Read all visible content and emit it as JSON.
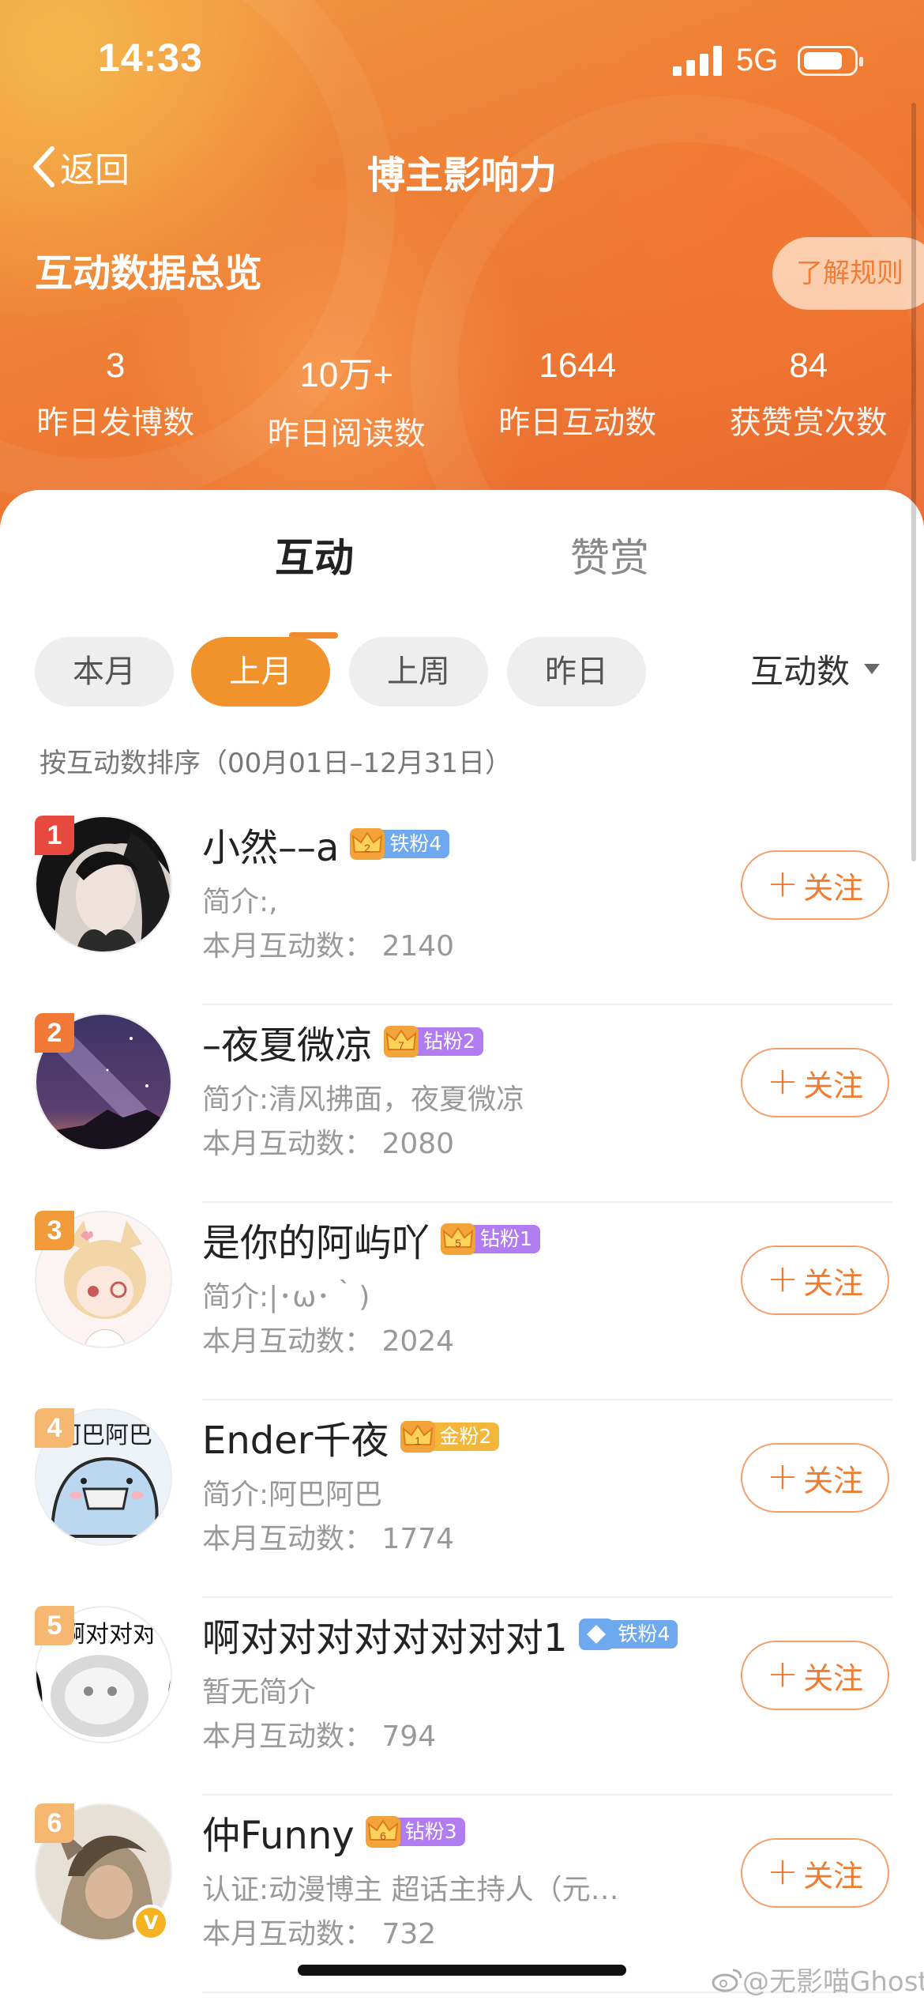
{
  "status_bar": {
    "time": "14:33",
    "network": "5G",
    "battery_level": 0.8
  },
  "nav": {
    "back_label": "返回",
    "title": "博主影响力"
  },
  "overview": {
    "title": "互动数据总览",
    "rules_button": "了解规则",
    "stats": [
      {
        "value": "3",
        "label": "昨日发博数"
      },
      {
        "value": "10万+",
        "label": "昨日阅读数"
      },
      {
        "value": "1644",
        "label": "昨日互动数"
      },
      {
        "value": "84",
        "label": "获赞赏次数"
      }
    ]
  },
  "tabs": [
    {
      "label": "互动",
      "active": true
    },
    {
      "label": "赞赏",
      "active": false
    }
  ],
  "filters": [
    {
      "label": "本月",
      "active": false
    },
    {
      "label": "上月",
      "active": true
    },
    {
      "label": "上周",
      "active": false
    },
    {
      "label": "昨日",
      "active": false
    }
  ],
  "sort": {
    "label": "互动数"
  },
  "sort_range": "按互动数排序（00月01日–12月31日）",
  "follow_label": "关注",
  "fans": [
    {
      "rank": "1",
      "name": "小然––a",
      "badge_level": "2",
      "badge": "铁粉4",
      "badge_color": "#6ea8ef",
      "bio": "简介:,",
      "count": "本月互动数： 2140",
      "rank_color": "#e8493e"
    },
    {
      "rank": "2",
      "name": "–夜夏微凉",
      "badge_level": "7",
      "badge": "钻粉2",
      "badge_color": "#b07cf0",
      "bio": "简介:清风拂面，夜夏微凉",
      "count": "本月互动数： 2080",
      "rank_color": "#f07a35"
    },
    {
      "rank": "3",
      "name": "是你的阿屿吖",
      "badge_level": "5",
      "badge": "钻粉1",
      "badge_color": "#b07cf0",
      "bio": "简介:|･ω･｀)",
      "count": "本月互动数： 2024",
      "rank_color": "#f29b3a"
    },
    {
      "rank": "4",
      "name": "Ender千夜",
      "badge_level": "1",
      "badge": "金粉2",
      "badge_color": "#f2b73a",
      "bio": "简介:阿巴阿巴",
      "count": "本月互动数： 1774",
      "rank_color": "#f6b870"
    },
    {
      "rank": "5",
      "name": "啊对对对对对对对对1",
      "badge_level": "",
      "badge": "铁粉4",
      "badge_color": "#6ea8ef",
      "bio": "暂无简介",
      "count": "本月互动数： 794",
      "rank_color": "#f6b870"
    },
    {
      "rank": "6",
      "name": "仲Funny",
      "badge_level": "6",
      "badge": "钻粉3",
      "badge_color": "#b07cf0",
      "bio": "认证:动漫博主 超话主持人（元…",
      "count": "本月互动数： 732",
      "rank_color": "#f6b870"
    }
  ],
  "verified_mark": "V",
  "watermark": "@无影喵Ghost"
}
